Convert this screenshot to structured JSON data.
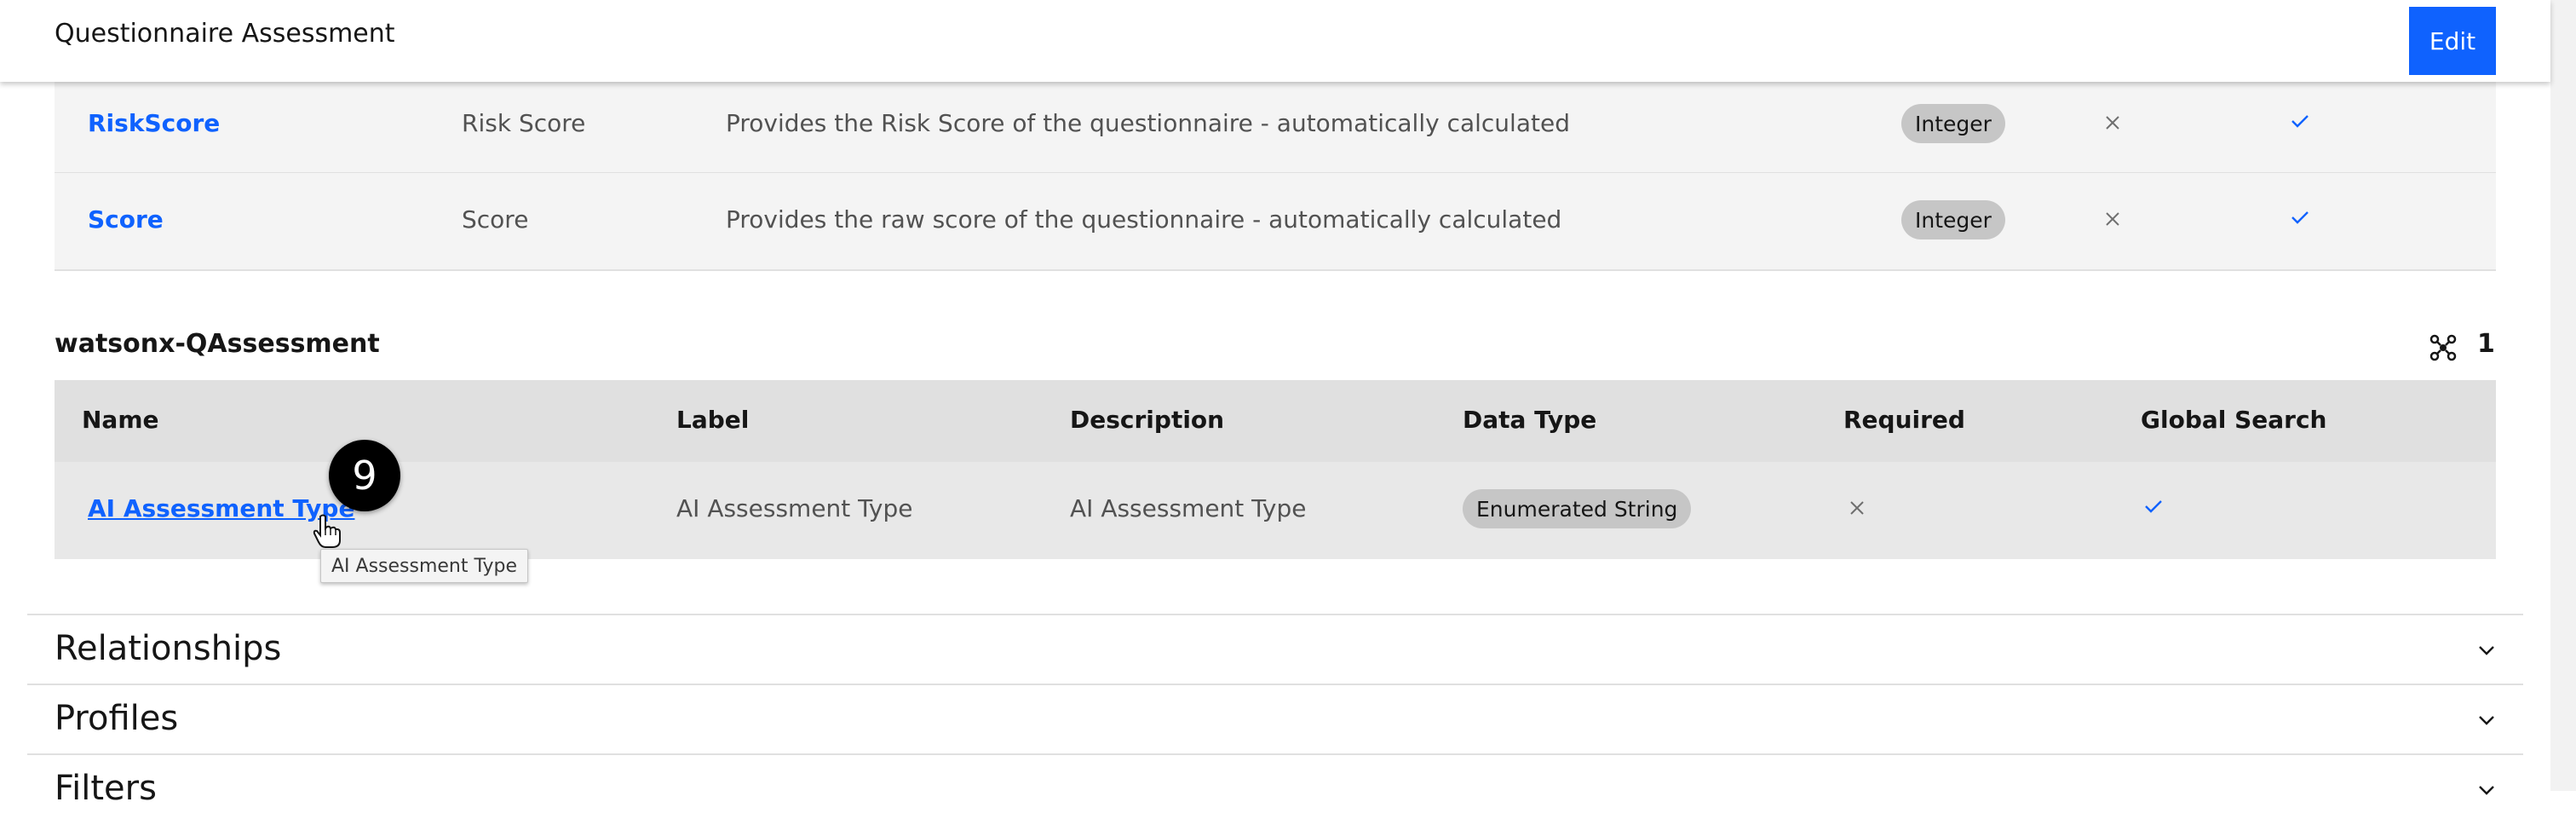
{
  "header": {
    "title": "Questionnaire Assessment",
    "edit_label": "Edit"
  },
  "previous_rows": [
    {
      "name": "RiskScore",
      "label": "Risk Score",
      "description": "Provides the Risk Score of the questionnaire - automatically calculated",
      "data_type": "Integer",
      "required": false,
      "global_search": true
    },
    {
      "name": "Score",
      "label": "Score",
      "description": "Provides the raw score of the questionnaire - automatically calculated",
      "data_type": "Integer",
      "required": false,
      "global_search": true
    }
  ],
  "section": {
    "title": "watsonx-QAssessment",
    "count": "1",
    "columns": [
      "Name",
      "Label",
      "Description",
      "Data Type",
      "Required",
      "Global Search"
    ],
    "rows": [
      {
        "name": "AI Assessment Type",
        "label": "AI Assessment Type",
        "description": "AI Assessment Type",
        "data_type": "Enumerated String",
        "required": false,
        "global_search": true
      }
    ]
  },
  "step_badge": "9",
  "tooltip": "AI Assessment Type",
  "accordions": [
    "Relationships",
    "Profiles",
    "Filters"
  ],
  "colors": {
    "accent": "#0f62fe",
    "tag_bg": "#c6c6c6",
    "row_bg": "#f4f4f4",
    "header_bg": "#e0e0e0"
  }
}
